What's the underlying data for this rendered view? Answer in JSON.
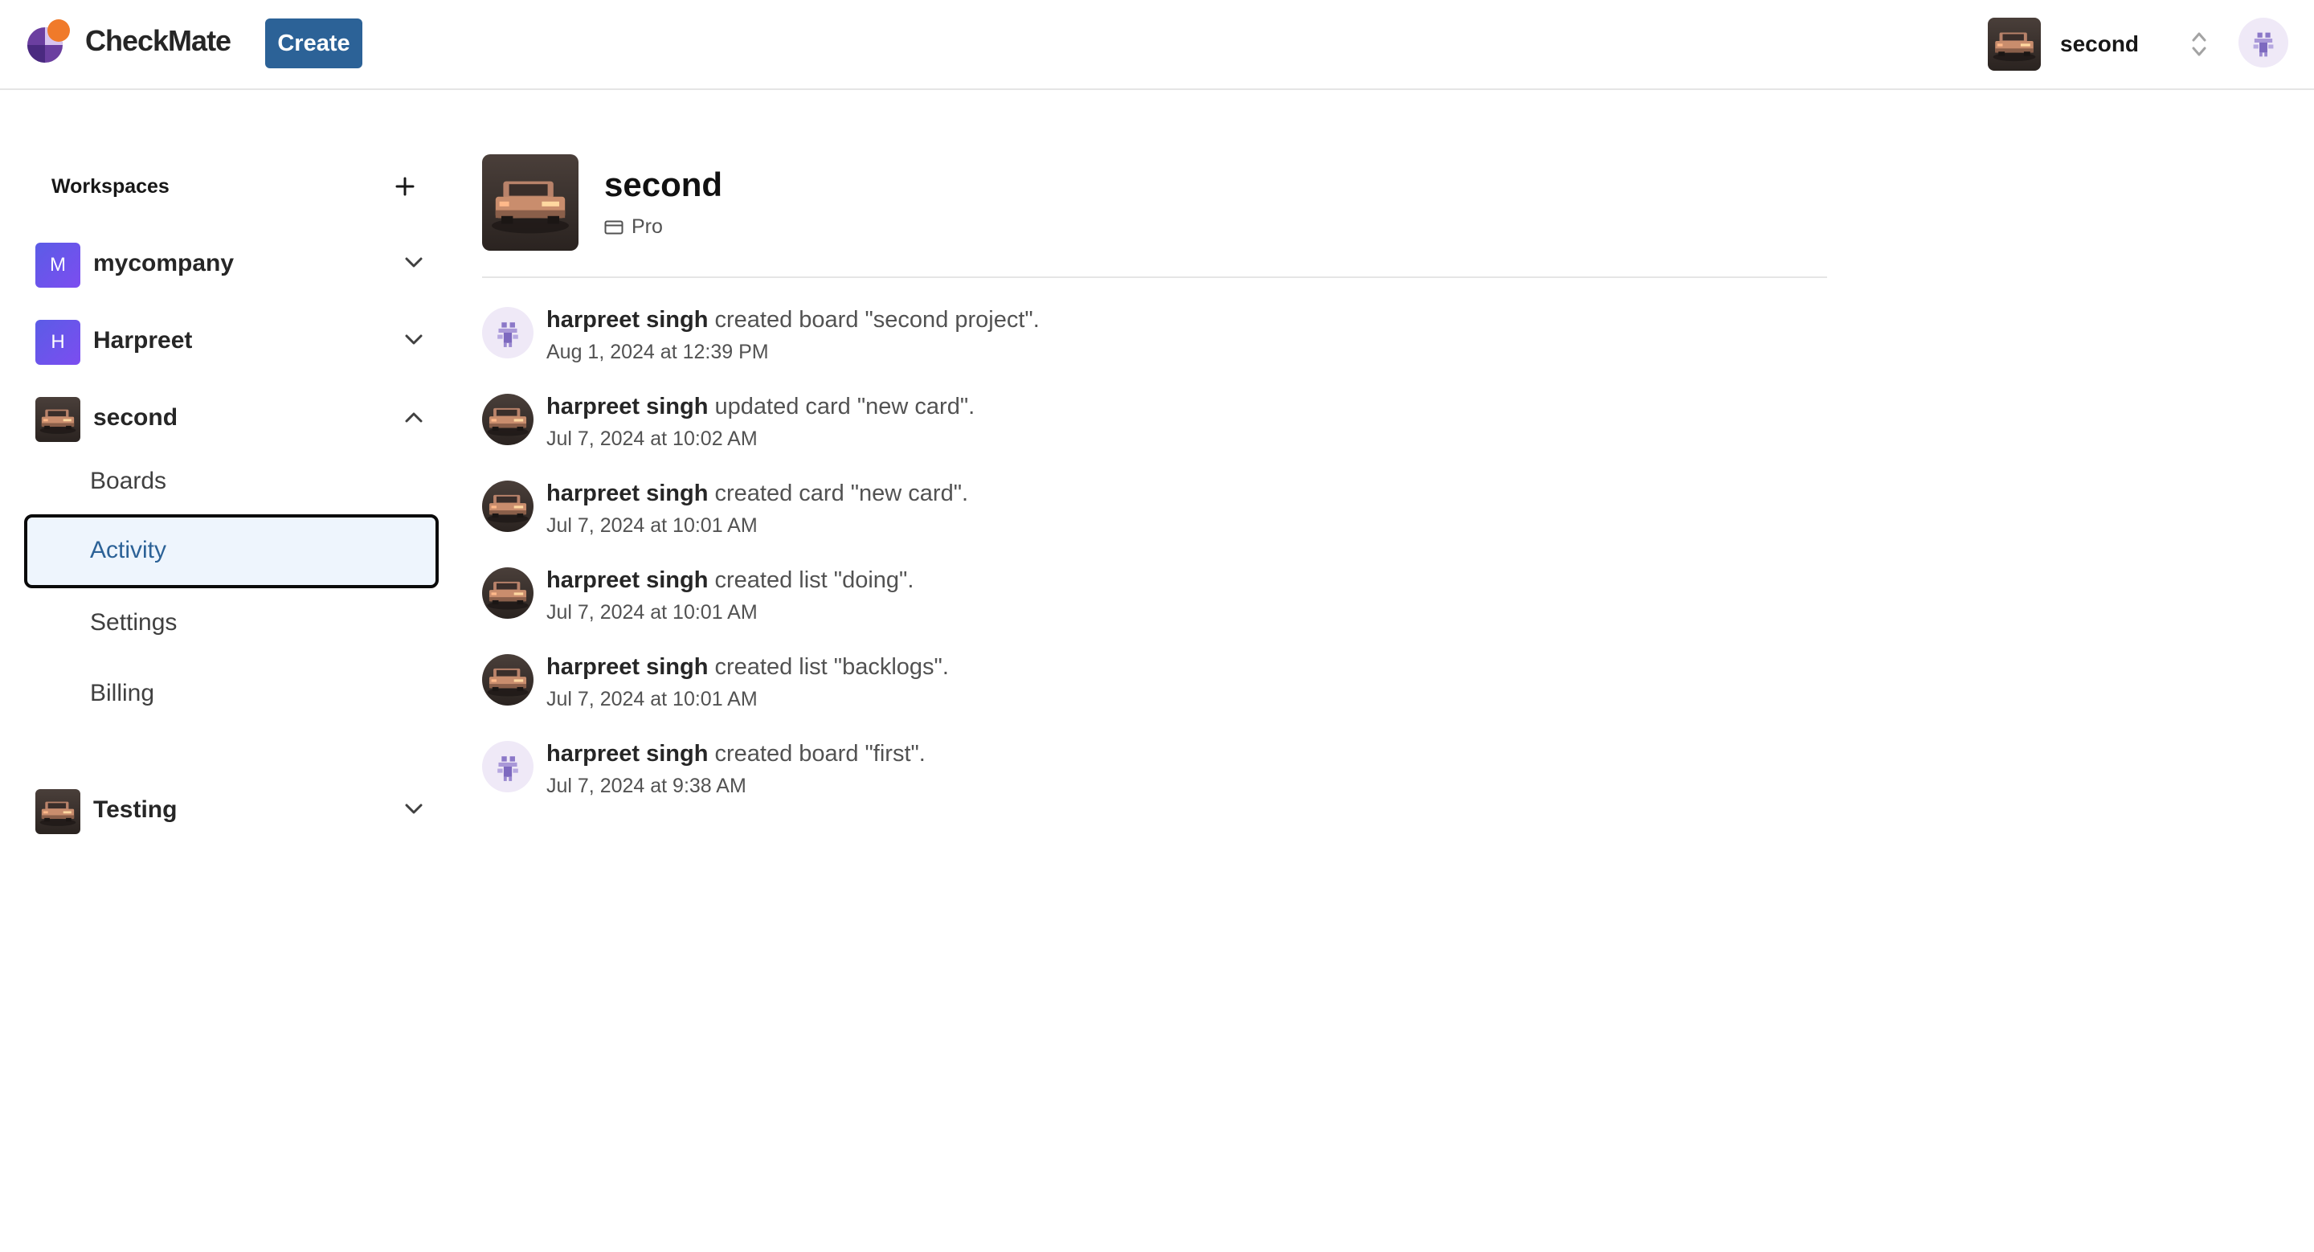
{
  "brand": {
    "name": "CheckMate"
  },
  "nav": {
    "create_label": "Create",
    "org_name": "second"
  },
  "sidebar": {
    "title": "Workspaces",
    "workspaces": [
      {
        "initial": "M",
        "name": "mycompany",
        "expanded": false
      },
      {
        "initial": "H",
        "name": "Harpreet",
        "expanded": false
      },
      {
        "initial": "",
        "name": "second",
        "expanded": true
      },
      {
        "initial": "",
        "name": "Testing",
        "expanded": false
      }
    ],
    "sub_items": [
      "Boards",
      "Activity",
      "Settings",
      "Billing"
    ],
    "active_item": "Activity"
  },
  "main": {
    "title": "second",
    "plan": "Pro",
    "activity": [
      {
        "user": "harpreet singh",
        "action": " created board \"second project\".",
        "time": "Aug 1, 2024 at 12:39 PM",
        "avatar": "user"
      },
      {
        "user": "harpreet singh",
        "action": " updated card \"new card\".",
        "time": "Jul 7, 2024 at 10:02 AM",
        "avatar": "car"
      },
      {
        "user": "harpreet singh",
        "action": " created card \"new card\".",
        "time": "Jul 7, 2024 at 10:01 AM",
        "avatar": "car"
      },
      {
        "user": "harpreet singh",
        "action": " created list \"doing\".",
        "time": "Jul 7, 2024 at 10:01 AM",
        "avatar": "car"
      },
      {
        "user": "harpreet singh",
        "action": " created list \"backlogs\".",
        "time": "Jul 7, 2024 at 10:01 AM",
        "avatar": "car"
      },
      {
        "user": "harpreet singh",
        "action": " created board \"first\".",
        "time": "Jul 7, 2024 at 9:38 AM",
        "avatar": "user"
      }
    ]
  },
  "colors": {
    "primary": "#2c6297",
    "active_bg": "#eef5fd",
    "badge_purple": "#6d54ea",
    "logo_orange": "#f07a2a",
    "logo_purple": "#6b3fa0"
  },
  "icons": [
    "logo-icon",
    "plus-icon",
    "chevron-down-icon",
    "chevron-up-icon",
    "updown-icon",
    "credit-card-icon"
  ]
}
